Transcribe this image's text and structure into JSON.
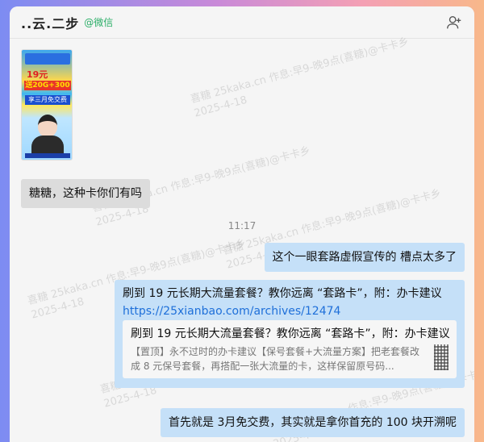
{
  "header": {
    "contact_name": "..云.二步",
    "contact_tag": "@微信"
  },
  "watermarks": [
    "喜糖 25kaka.cn 作息:早9-晚9点(喜糖)@卡卡乡",
    "2025-4-18"
  ],
  "thumbnail": {
    "price": "19元",
    "banner": "送20G+300",
    "offer": "享三月免交费"
  },
  "messages": [
    {
      "side": "left",
      "text": "糖糖，这种卡你们有吗"
    },
    {
      "timestamp": "11:17"
    },
    {
      "side": "right",
      "text": "这个一眼套路虚假宣传的  槽点太多了"
    },
    {
      "side": "right",
      "text_before": "刷到 19 元长期大流量套餐？教你远离 “套路卡”，附：办卡建议 ",
      "link": "https://25xianbao.com/archives/12474",
      "card": {
        "title": "刷到 19 元长期大流量套餐？教你远离 “套路卡”，附：办卡建议",
        "description": "【置顶】永不过时的办卡建议【保号套餐+大流量方案】把老套餐改成 8 元保号套餐，再搭配一张大流量的卡，这样保留原号码..."
      }
    },
    {
      "side": "right",
      "text": "首先就是 3月免交费，其实就是拿你首充的 100 块开溯呢"
    }
  ]
}
